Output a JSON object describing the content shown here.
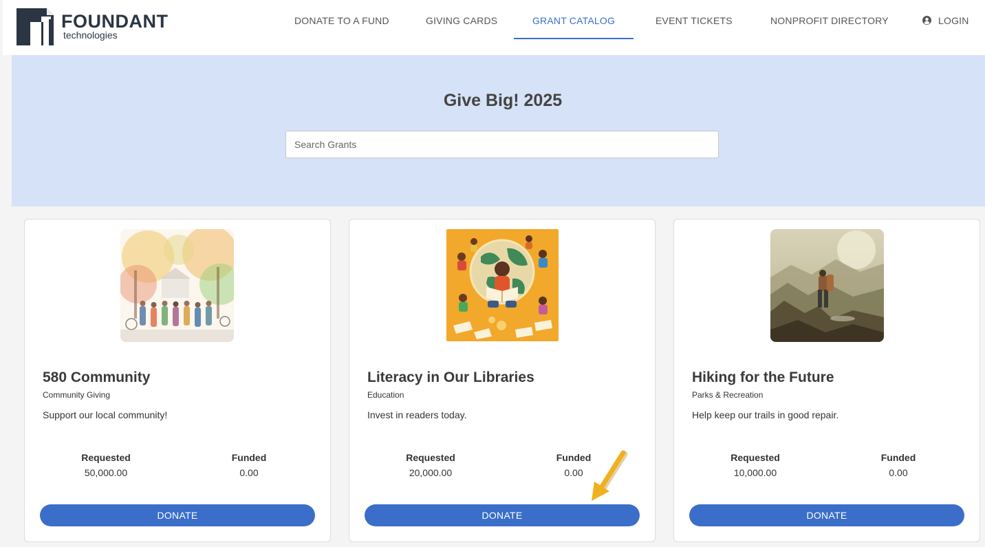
{
  "brand": {
    "name": "FOUNDANT",
    "tagline": "technologies",
    "color": "#2b3543"
  },
  "nav": {
    "items": [
      {
        "label": "DONATE TO A FUND"
      },
      {
        "label": "GIVING CARDS"
      },
      {
        "label": "GRANT CATALOG",
        "active": true
      },
      {
        "label": "EVENT TICKETS"
      },
      {
        "label": "NONPROFIT DIRECTORY"
      }
    ],
    "login": {
      "label": "LOGIN",
      "icon": "user-circle-icon"
    },
    "accent_color": "#3a6ec8"
  },
  "hero": {
    "title": "Give Big! 2025",
    "search_placeholder": "Search Grants",
    "background": "#d6e2f7"
  },
  "grants": [
    {
      "title": "580 Community",
      "category": "Community Giving",
      "description": "Support our local community!",
      "requested_label": "Requested",
      "requested": "50,000.00",
      "funded_label": "Funded",
      "funded": "0.00",
      "button": "DONATE",
      "image": "watercolor-community-image"
    },
    {
      "title": "Literacy in Our Libraries",
      "category": "Education",
      "description": "Invest in readers today.",
      "requested_label": "Requested",
      "requested": "20,000.00",
      "funded_label": "Funded",
      "funded": "0.00",
      "button": "DONATE",
      "image": "children-reading-globe-image"
    },
    {
      "title": "Hiking for the Future",
      "category": "Parks & Recreation",
      "description": "Help keep our trails in good repair.",
      "requested_label": "Requested",
      "requested": "10,000.00",
      "funded_label": "Funded",
      "funded": "0.00",
      "button": "DONATE",
      "image": "hiker-mountain-image"
    }
  ],
  "annotation": {
    "icon": "pointer-arrow-icon",
    "color": "#f0b020"
  }
}
